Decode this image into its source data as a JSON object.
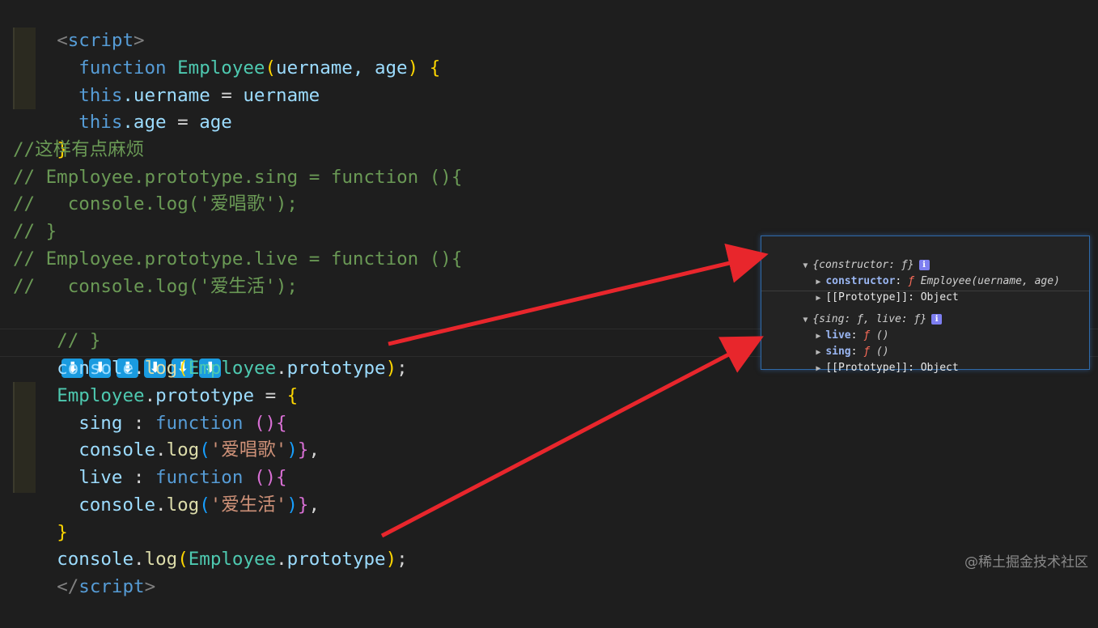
{
  "code_lines": {
    "l1": {
      "open": "<",
      "tag": "script",
      "close": ">"
    },
    "l2": {
      "kw": "function",
      "name": "Employee",
      "p1": "(",
      "args": "uername, age",
      "p2": ")",
      "brace": "{"
    },
    "l3": {
      "kw": "this",
      "prop": ".uername",
      "eq": " = ",
      "val": "uername"
    },
    "l4": {
      "kw": "this",
      "prop": ".age",
      "eq": " = ",
      "val": "age"
    },
    "l5": {
      "brace": "}"
    },
    "l6": {
      "comment": "//这样有点麻烦"
    },
    "l7": {
      "comment": "// Employee.prototype.sing = function (){"
    },
    "l8": {
      "comment": "//   console.log('爱唱歌');"
    },
    "l9": {
      "comment": "// }"
    },
    "l10": {
      "comment": "// Employee.prototype.live = function (){"
    },
    "l11": {
      "comment": "//   console.log('爱生活');"
    },
    "l12": {
      "comment": "// }",
      "arrows": [
        "⬇",
        "⬇",
        "⬇",
        "⬇",
        "⬇",
        "⬇"
      ]
    },
    "l13": {
      "obj": "console",
      "dot1": ".",
      "method": "log",
      "p1": "(",
      "cls": "Employee",
      "dot2": ".",
      "prop": "prototype",
      "p2": ")",
      "semi": ";"
    },
    "l14": {
      "cls": "Employee",
      "dot": ".",
      "prop": "prototype",
      "eq": " = ",
      "brace": "{"
    },
    "l15": {
      "key": "sing",
      "colon": " : ",
      "kw": "function",
      "sp": " ",
      "parens": "()",
      "brace": "{"
    },
    "l16": {
      "obj": "console",
      "dot": ".",
      "method": "log",
      "p1": "(",
      "str": "'爱唱歌'",
      "p2": ")",
      "brace": "}",
      "comma": ","
    },
    "l17": {
      "key": "live",
      "colon": " : ",
      "kw": "function",
      "sp": " ",
      "parens": "()",
      "brace": "{"
    },
    "l18": {
      "obj": "console",
      "dot": ".",
      "method": "log",
      "p1": "(",
      "str": "'爱生活'",
      "p2": ")",
      "brace": "}",
      "comma": ","
    },
    "l19": {
      "brace": "}"
    },
    "l20": {
      "obj": "console",
      "dot1": ".",
      "method": "log",
      "p1": "(",
      "cls": "Employee",
      "dot2": ".",
      "prop": "prototype",
      "p2": ")",
      "semi": ";"
    },
    "l21": {
      "open": "</",
      "tag": "script",
      "close": ">"
    }
  },
  "console_output": {
    "block1": {
      "summary": "{constructor: ƒ}",
      "badge": "i",
      "rows": [
        {
          "key": "constructor",
          "sep": ": ",
          "f": "ƒ",
          "value": " Employee(uername, age)"
        },
        {
          "key": "[[Prototype]]",
          "sep": ": ",
          "value": "Object"
        }
      ]
    },
    "block2": {
      "summary": "{sing: ƒ, live: ƒ}",
      "badge": "i",
      "rows": [
        {
          "key": "live",
          "sep": ": ",
          "f": "ƒ",
          "value": " ()"
        },
        {
          "key": "sing",
          "sep": ": ",
          "f": "ƒ",
          "value": " ()"
        },
        {
          "key": "[[Prototype]]",
          "sep": ": ",
          "value": "Object"
        }
      ]
    }
  },
  "watermark": "@稀土掘金技术社区",
  "colors": {
    "background": "#1e1e1e",
    "arrow": "#e8262c",
    "keyword": "#569cd6",
    "class": "#4ec9b0",
    "comment": "#6a9955",
    "string": "#ce9178"
  }
}
